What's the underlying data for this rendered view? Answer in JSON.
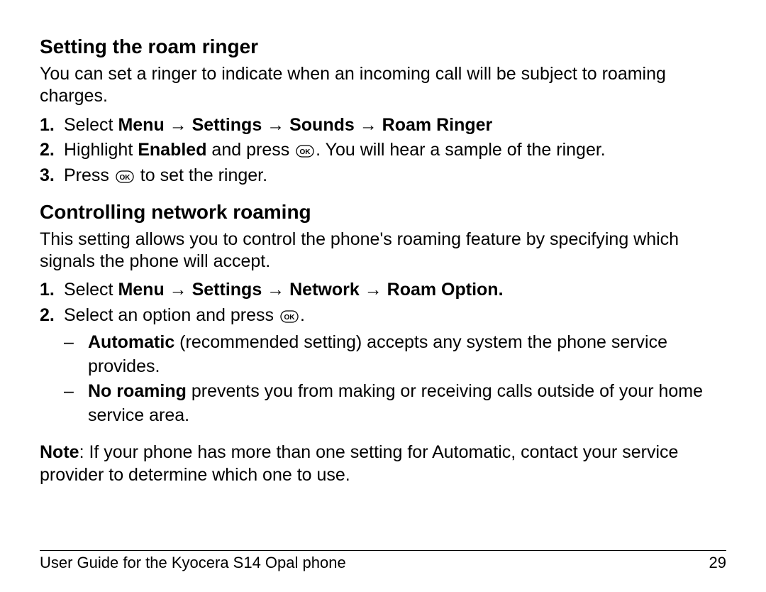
{
  "section1": {
    "heading": "Setting the roam ringer",
    "intro": "You can set a ringer to indicate when an incoming call will be subject to roaming charges.",
    "steps": [
      {
        "n": "1.",
        "prefix": "Select ",
        "bold": "Menu → Settings → Sounds → Roam Ringer",
        "suffix": ""
      },
      {
        "n": "2.",
        "a": "Highlight ",
        "b": "Enabled",
        "c": " and press ",
        "d": ". You will hear a sample of the ringer."
      },
      {
        "n": "3.",
        "a": "Press ",
        "b": " to set the ringer."
      }
    ]
  },
  "section2": {
    "heading": "Controlling network roaming",
    "intro": "This setting allows you to control the phone's roaming feature by specifying which signals the phone will accept.",
    "steps": [
      {
        "n": "1.",
        "prefix": "Select ",
        "bold": "Menu → Settings → Network → Roam Option.",
        "suffix": ""
      },
      {
        "n": "2.",
        "a": "Select an option and press ",
        "b": "."
      }
    ],
    "sub": [
      {
        "dash": "–",
        "bold": "Automatic",
        "rest": " (recommended setting) accepts any system the phone service provides."
      },
      {
        "dash": "–",
        "bold": "No roaming",
        "rest": " prevents you from making or receiving calls outside of your home service area."
      }
    ],
    "note_label": "Note",
    "note_rest": ": If your phone has more than one setting for Automatic, contact your service provider to determine which one to use."
  },
  "footer": {
    "left": "User Guide for the Kyocera S14 Opal phone",
    "right": "29"
  },
  "ok_label": "OK"
}
